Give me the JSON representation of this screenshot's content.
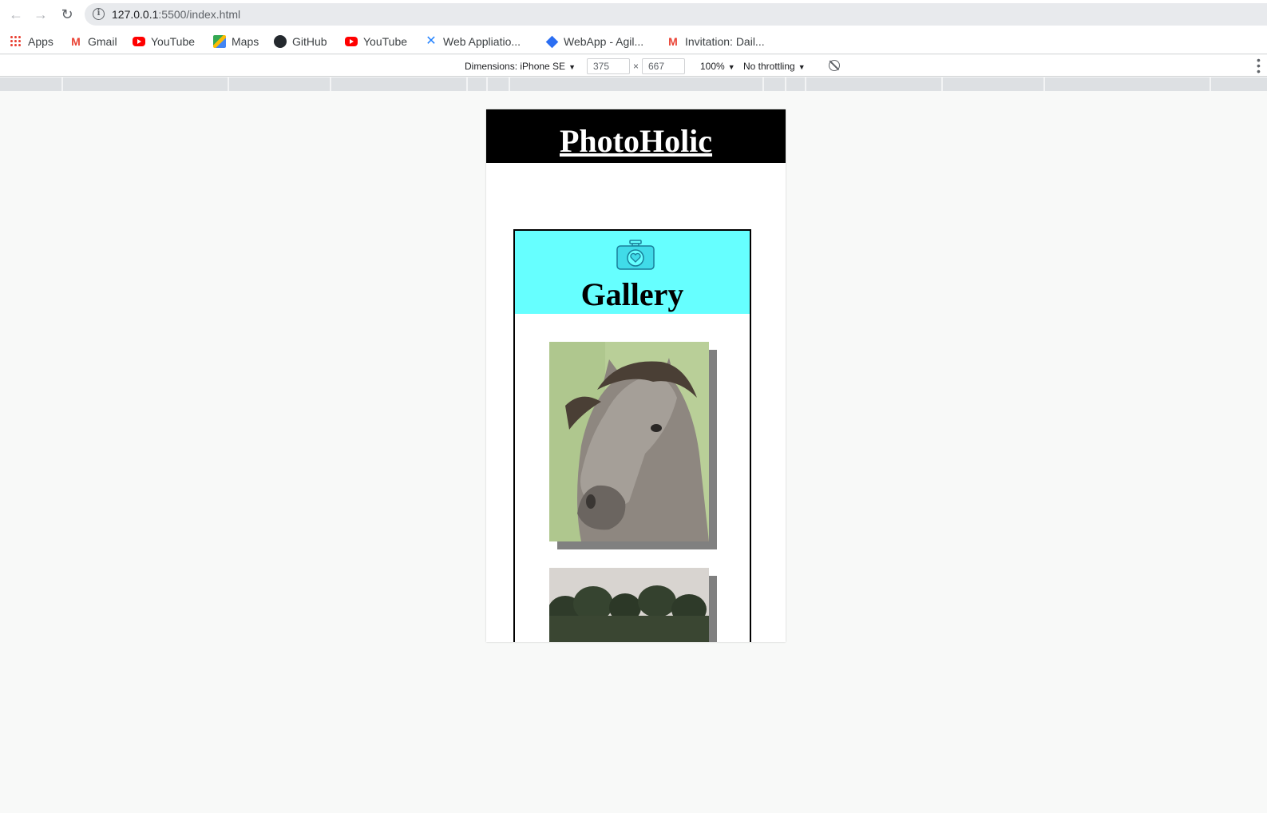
{
  "browser": {
    "url_host": "127.0.0.1",
    "url_rest": ":5500/index.html",
    "bookmarks": [
      {
        "label": "Apps",
        "icon": "apps-grid-icon"
      },
      {
        "label": "Gmail",
        "icon": "gmail-icon"
      },
      {
        "label": "YouTube",
        "icon": "youtube-icon"
      },
      {
        "label": "Maps",
        "icon": "maps-icon"
      },
      {
        "label": "GitHub",
        "icon": "github-icon"
      },
      {
        "label": "YouTube",
        "icon": "youtube-icon"
      },
      {
        "label": "Web Appliatio...",
        "icon": "confluence-icon"
      },
      {
        "label": "WebApp - Agil...",
        "icon": "jira-icon"
      },
      {
        "label": "Invitation: Dail...",
        "icon": "gmail-icon"
      }
    ]
  },
  "devtools": {
    "dimensions_label": "Dimensions: iPhone SE",
    "width_value": "375",
    "height_value": "667",
    "times": "×",
    "zoom": "100%",
    "throttling": "No throttling"
  },
  "site": {
    "title": "PhotoHolic",
    "gallery_title": "Gallery",
    "gallery_icon": "camera-heart-icon",
    "photos": [
      {
        "name": "horse-photo",
        "subject": "horse portrait"
      },
      {
        "name": "forest-photo",
        "subject": "pine trees"
      }
    ],
    "colors": {
      "header_bg": "#000000",
      "gallery_head_bg": "#66ffff",
      "photo_shadow": "#808080"
    }
  }
}
